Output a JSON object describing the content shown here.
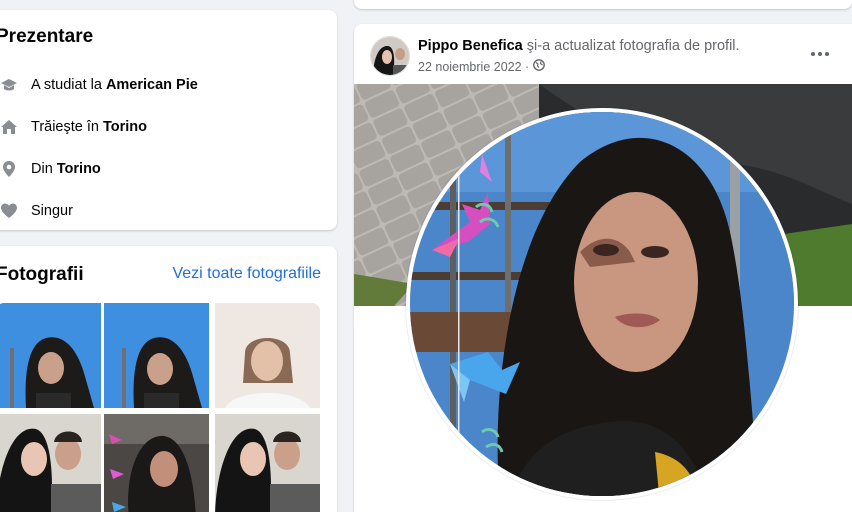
{
  "intro": {
    "title": "Prezentare",
    "items": [
      {
        "icon": "graduation-cap-icon",
        "prefix": "A studiat la",
        "value": "American Pie"
      },
      {
        "icon": "home-icon",
        "prefix": "Trăieşte în",
        "value": "Torino"
      },
      {
        "icon": "location-pin-icon",
        "prefix": "Din",
        "value": "Torino"
      },
      {
        "icon": "heart-icon",
        "prefix": "Singur",
        "value": ""
      }
    ]
  },
  "photos": {
    "title": "Fotografii",
    "see_all": "Vezi toate fotografiile",
    "count_visible": 6
  },
  "post": {
    "author": "Pippo Benefica",
    "action": "şi-a actualizat fotografia de profil.",
    "date": "22 noiembrie 2022 ·",
    "privacy_icon": "globe-icon"
  },
  "colors": {
    "link": "#216fdb",
    "secondary_text": "#65676b",
    "background": "#f0f2f5"
  }
}
